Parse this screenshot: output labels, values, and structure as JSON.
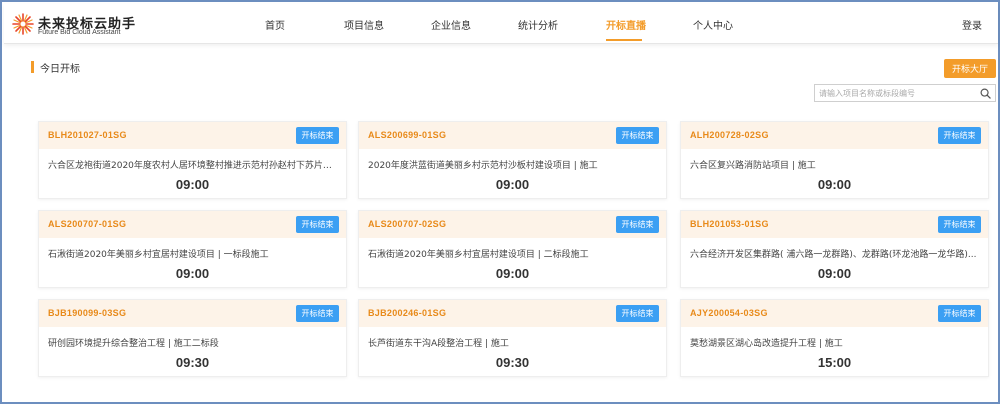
{
  "app": {
    "name": "未来投标云助手",
    "subtitle": "Future Bid Cloud Assistant"
  },
  "nav": {
    "items": [
      {
        "label": "首页"
      },
      {
        "label": "项目信息"
      },
      {
        "label": "企业信息"
      },
      {
        "label": "统计分析"
      },
      {
        "label": "开标直播"
      },
      {
        "label": "个人中心"
      }
    ],
    "active_index": 4,
    "login_label": "登录"
  },
  "section": {
    "title": "今日开标",
    "hall_button_label": "开标大厅"
  },
  "search": {
    "placeholder": "请输入项目名称或标段编号"
  },
  "colors": {
    "accent": "#f39c2a",
    "status_button": "#3b9ff3",
    "card_header_bg": "#fdf3e8",
    "code_text": "#e88a1a"
  },
  "cards": [
    {
      "code": "BLH201027-01SG",
      "status": "开标结束",
      "name": "六合区龙袍街道2020年度农村人居环境整村推进示范村孙赵村下苏片区...",
      "time": "09:00"
    },
    {
      "code": "ALS200699-01SG",
      "status": "开标结束",
      "name": "2020年度洪蓝街道美丽乡村示范村沙板村建设项目 | 施工",
      "time": "09:00"
    },
    {
      "code": "ALH200728-02SG",
      "status": "开标结束",
      "name": "六合区复兴路消防站项目 | 施工",
      "time": "09:00"
    },
    {
      "code": "ALS200707-01SG",
      "status": "开标结束",
      "name": "石湫街道2020年美丽乡村宜居村建设项目 | 一标段施工",
      "time": "09:00"
    },
    {
      "code": "ALS200707-02SG",
      "status": "开标结束",
      "name": "石湫街道2020年美丽乡村宜居村建设项目 | 二标段施工",
      "time": "09:00"
    },
    {
      "code": "BLH201053-01SG",
      "status": "开标结束",
      "name": "六合经济开发区集群路( 浦六路一龙群路)、龙群路(环龙池路一龙华路)...",
      "time": "09:00"
    },
    {
      "code": "BJB190099-03SG",
      "status": "开标结束",
      "name": "研创园环境提升综合整治工程 | 施工二标段",
      "time": "09:30"
    },
    {
      "code": "BJB200246-01SG",
      "status": "开标结束",
      "name": "长芦街道东干沟A段整治工程 | 施工",
      "time": "09:30"
    },
    {
      "code": "AJY200054-03SG",
      "status": "开标结束",
      "name": "莫愁湖景区湖心岛改造提升工程 | 施工",
      "time": "15:00"
    }
  ]
}
